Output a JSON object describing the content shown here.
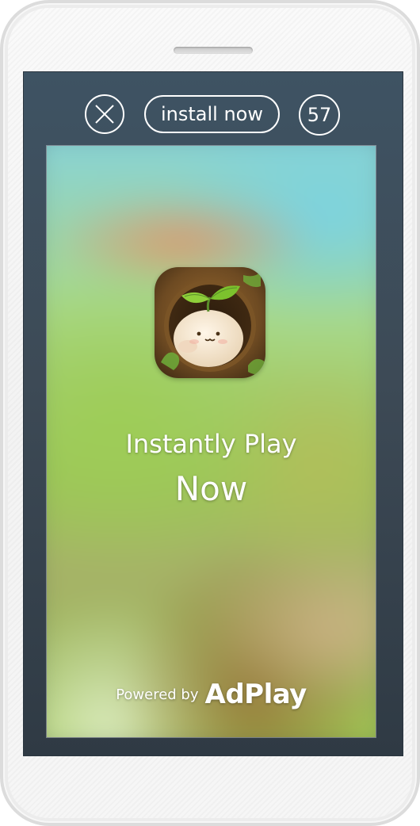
{
  "ad_bar": {
    "install_label": "install now",
    "countdown": "57"
  },
  "creative": {
    "headline_line1": "Instantly Play",
    "headline_line2": "Now",
    "powered_by": "Powered by",
    "brand": "AdPlay"
  },
  "icons": {
    "close": "close-icon",
    "app": "app-icon"
  },
  "colors": {
    "screen_bg": "#3d4a56",
    "button_outline": "#ffffff",
    "text": "#ffffff"
  }
}
